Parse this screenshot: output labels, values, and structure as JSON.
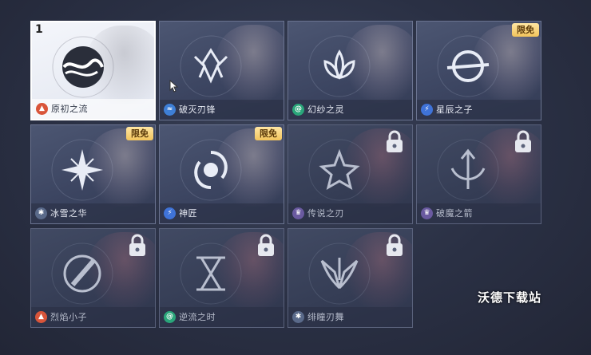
{
  "selected_slot_number": "1",
  "badge_text": "限免",
  "watermark": "沃德下载站",
  "cards": [
    {
      "name": "原初之流",
      "school_icon": "fire-school-icon",
      "school_color": "#d9553a",
      "emblem": "wave-orb-emblem",
      "state": "selected",
      "badge": false
    },
    {
      "name": "破灭刃锋",
      "school_icon": "water-school-icon",
      "school_color": "#3e7fd6",
      "emblem": "crystal-crown-emblem",
      "state": "unlocked",
      "badge": false
    },
    {
      "name": "幻纱之灵",
      "school_icon": "wind-school-icon",
      "school_color": "#2aa67a",
      "emblem": "lotus-emblem",
      "state": "unlocked",
      "badge": false
    },
    {
      "name": "星辰之子",
      "school_icon": "thunder-school-icon",
      "school_color": "#3f73d8",
      "emblem": "planet-ring-emblem",
      "state": "unlocked",
      "badge": true
    },
    {
      "name": "冰雪之华",
      "school_icon": "ice-school-icon",
      "school_color": "#5a6a8a",
      "emblem": "snowflake-emblem",
      "state": "unlocked",
      "badge": true
    },
    {
      "name": "神匠",
      "school_icon": "thunder-school-icon",
      "school_color": "#3f73d8",
      "emblem": "swirl-eye-emblem",
      "state": "unlocked",
      "badge": true
    },
    {
      "name": "传说之刃",
      "school_icon": "dark-school-icon",
      "school_color": "#6a5aa0",
      "emblem": "flower-star-emblem",
      "state": "locked",
      "badge": false
    },
    {
      "name": "破魔之箭",
      "school_icon": "dark-school-icon",
      "school_color": "#6a5aa0",
      "emblem": "arrow-bow-emblem",
      "state": "locked",
      "badge": false
    },
    {
      "name": "烈焰小子",
      "school_icon": "fire-school-icon",
      "school_color": "#d9553a",
      "emblem": "flame-slash-emblem",
      "state": "locked",
      "badge": false
    },
    {
      "name": "逆流之时",
      "school_icon": "wind-school-icon",
      "school_color": "#2aa67a",
      "emblem": "hourglass-emblem",
      "state": "locked",
      "badge": false
    },
    {
      "name": "绯瞳刃舞",
      "school_icon": "ice-school-icon",
      "school_color": "#5a6a8a",
      "emblem": "wing-blade-emblem",
      "state": "locked",
      "badge": false
    }
  ]
}
